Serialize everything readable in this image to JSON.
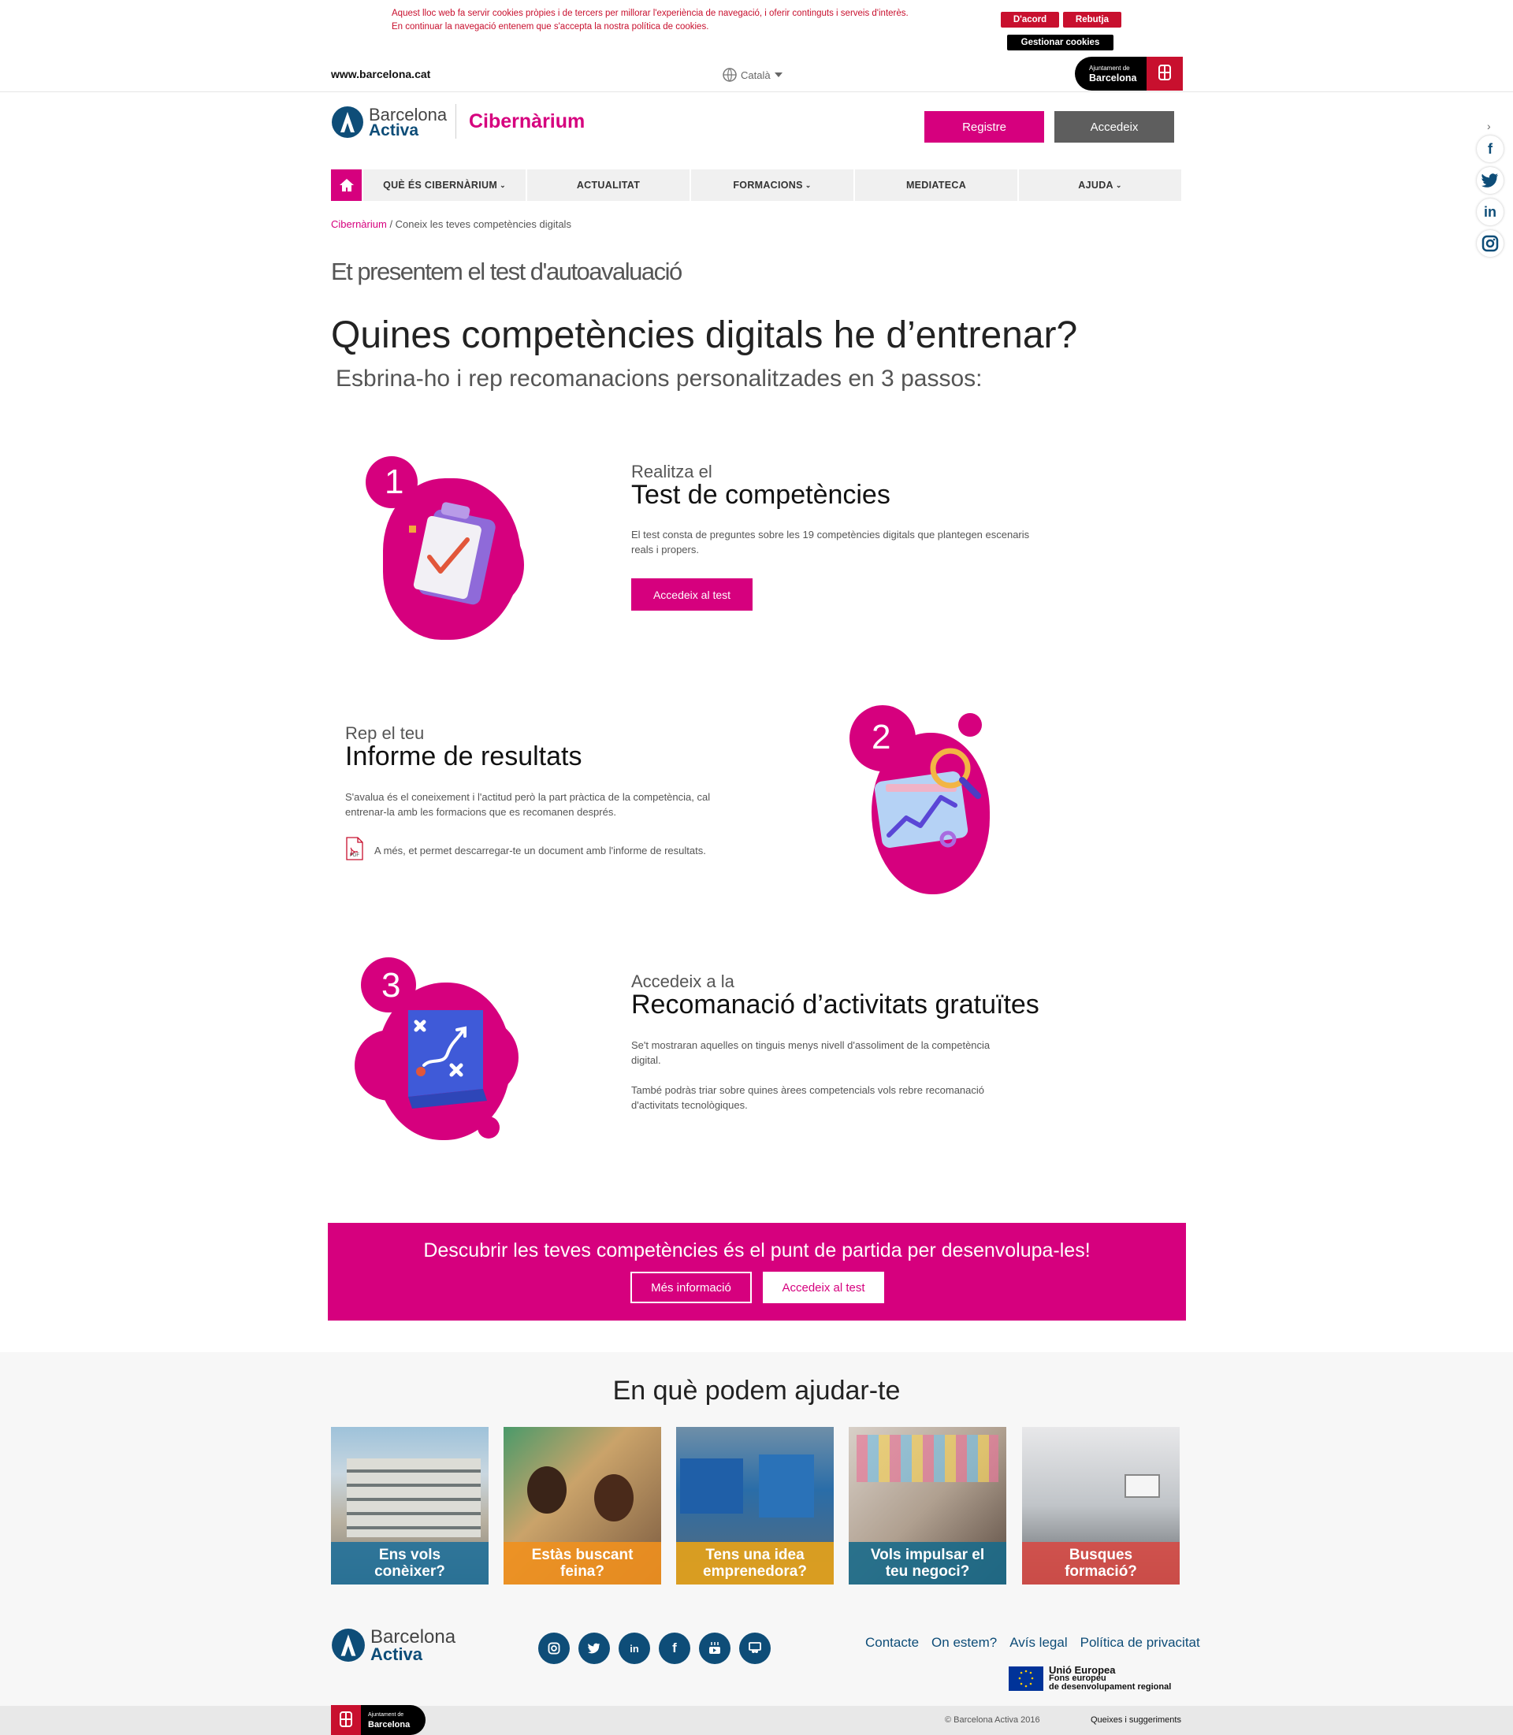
{
  "cookie": {
    "text_line1": "Aquest lloc web fa servir cookies pròpies i de tercers per millorar l'experiència de navegació, i oferir continguts i serveis d'interès.",
    "text_line2": "En continuar la navegació entenem que s'accepta la nostra política de cookies.",
    "accept": "D'acord",
    "reject": "Rebutja",
    "manage": "Gestionar cookies"
  },
  "topbar": {
    "url": "www.barcelona.cat",
    "language": "Català",
    "ajuntament_small": "Ajuntament de",
    "ajuntament_big": "Barcelona"
  },
  "header": {
    "logo_line1": "Barcelona",
    "logo_line2": "Activa",
    "brand": "Cibernàrium",
    "register": "Registre",
    "login": "Accedeix"
  },
  "social_side": [
    "facebook-icon",
    "twitter-icon",
    "linkedin-icon",
    "instagram-icon"
  ],
  "nav": {
    "items": [
      "QUÈ ÉS CIBERNÀRIUM",
      "ACTUALITAT",
      "FORMACIONS",
      "MEDIATECA",
      "AJUDA"
    ]
  },
  "breadcrumb": {
    "home": "Cibernàrium",
    "current": "/ Coneix les teves competències digitals"
  },
  "intro": {
    "kicker": "Et presentem el test d'autoavaluació",
    "title": "Quines competències digitals he d’entrenar?",
    "subtitle": "Esbrina-ho i rep recomanacions personalitzades en 3 passos:"
  },
  "steps": [
    {
      "number": "1",
      "pre": "Realitza el",
      "title": "Test de competències",
      "desc": "El test consta de preguntes sobre les 19 competències digitals que plantegen escenaris reals i propers.",
      "button": "Accedeix al test"
    },
    {
      "number": "2",
      "pre": "Rep el teu",
      "title": "Informe de resultats",
      "desc": "S'avalua és el coneixement i l'actitud però la part pràctica de la competència, cal entrenar-la amb les formacions que es recomanen després.",
      "pdf_label": "PDF",
      "note": "A més, et permet descarregar-te un document amb l'informe de resultats."
    },
    {
      "number": "3",
      "pre": "Accedeix a la",
      "title": "Recomanació d’activitats gratuïtes",
      "desc1": "Se't mostraran aquelles on tinguis menys nivell d'assoliment de la competència digital.",
      "desc2": "També podràs triar sobre quines àrees competencials vols rebre recomanació d'activitats tecnològiques."
    }
  ],
  "banner": {
    "text": "Descubrir les teves competències és el punt de partida per desenvolupa-les!",
    "more": "Més informació",
    "test": "Accedeix al test"
  },
  "help": {
    "title": "En què podem ajudar-te",
    "cards": [
      {
        "line1": "Ens vols",
        "line2": "conèixer?",
        "color": "#1f6f9a"
      },
      {
        "line1": "Estàs buscant",
        "line2": "feina?",
        "color": "#f0901e"
      },
      {
        "line1": "Tens una idea",
        "line2": "emprenedora?",
        "color": "#e8a317"
      },
      {
        "line1": "Vols impulsar el",
        "line2": "teu negoci?",
        "color": "#1a6a8a"
      },
      {
        "line1": "Busques",
        "line2": "formació?",
        "color": "#d64a45"
      }
    ]
  },
  "footer": {
    "logo_line1": "Barcelona",
    "logo_line2": "Activa",
    "social": [
      "instagram-icon",
      "twitter-icon",
      "linkedin-icon",
      "facebook-icon",
      "youtube-icon",
      "slideshare-icon"
    ],
    "links": [
      "Contacte",
      "On estem?",
      "Avís legal",
      "Política de privacitat"
    ],
    "eu1": "Unió Europea",
    "eu2": "Fons europeu",
    "eu3": "de desenvolupament regional",
    "aj_small": "Ajuntament de",
    "aj_big": "Barcelona",
    "copyright": "© Barcelona Activa 2016",
    "complaints": "Queixes i suggeriments"
  }
}
